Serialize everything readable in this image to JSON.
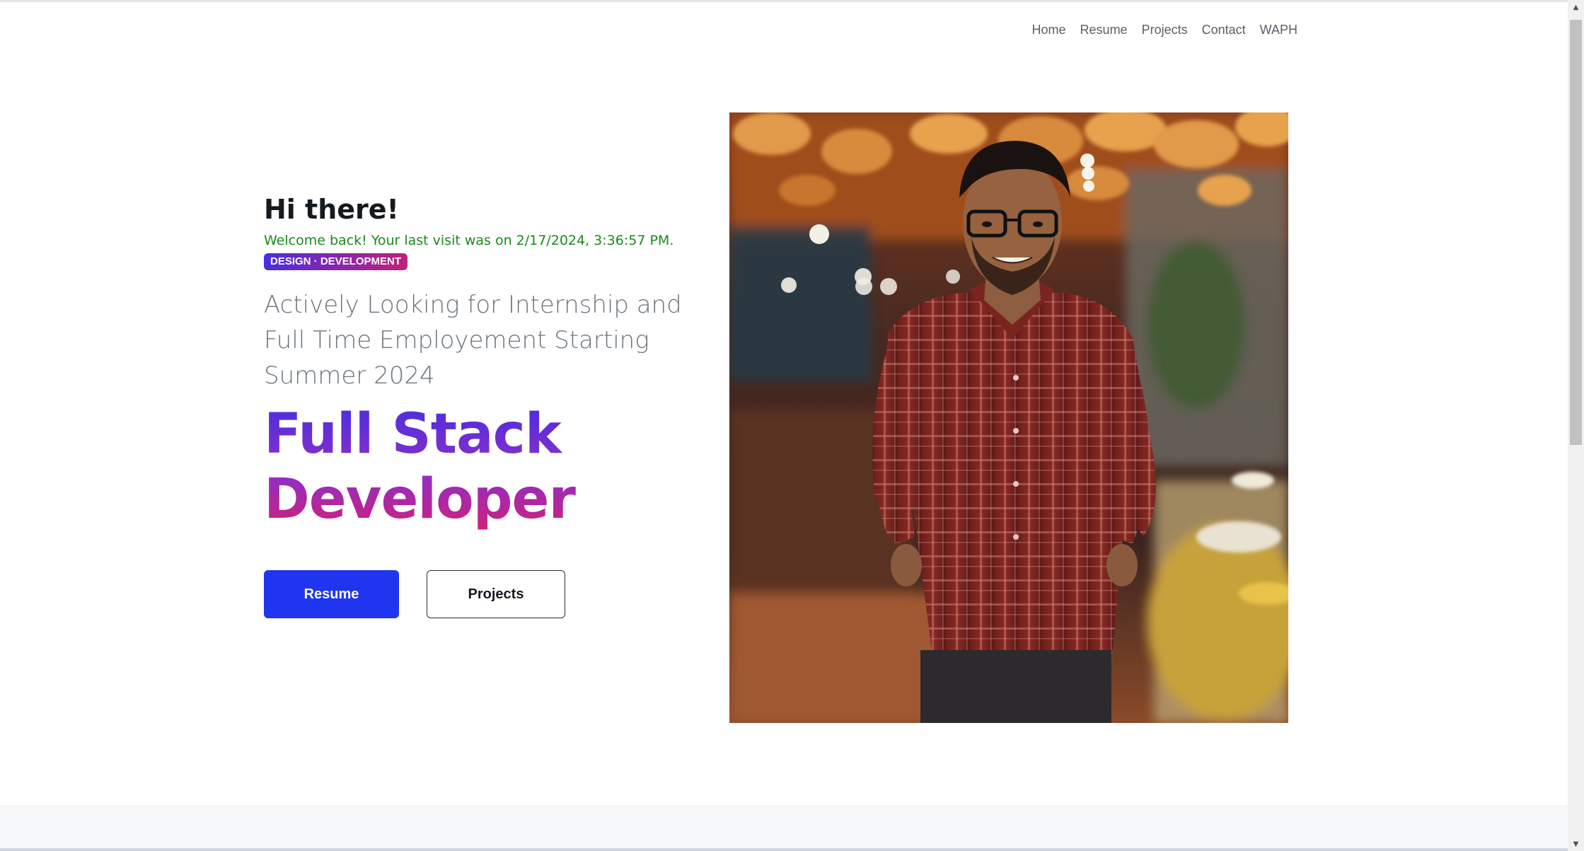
{
  "nav": {
    "items": [
      {
        "label": "Home"
      },
      {
        "label": "Resume"
      },
      {
        "label": "Projects"
      },
      {
        "label": "Contact"
      },
      {
        "label": "WAPH"
      }
    ]
  },
  "hero": {
    "greeting": "Hi there!",
    "welcome": "Welcome back! Your last visit was on 2/17/2024, 3:36:57 PM.",
    "tag": "DESIGN · DEVELOPMENT",
    "tagline": "Actively Looking for Internship and Full Time Employement Starting Summer 2024",
    "role_line1": "Full Stack",
    "role_line2": "Developer",
    "buttons": {
      "resume": "Resume",
      "projects": "Projects"
    }
  },
  "colors": {
    "primary_button": "#1f35f0",
    "gradient_start": "#4a2ee0",
    "gradient_end": "#d31f78",
    "welcome_text": "#1a8a1a"
  },
  "icons": {
    "scroll_up": "triangle-up-icon",
    "scroll_down": "triangle-down-icon"
  }
}
